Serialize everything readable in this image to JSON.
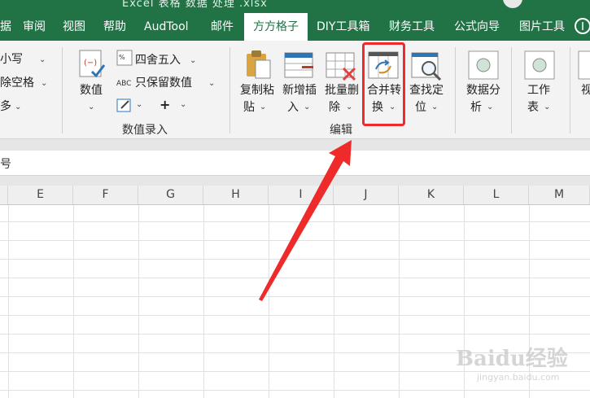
{
  "titlebar": {
    "title": "Excel 表格 数据 处理 .xlsx"
  },
  "tabs": [
    {
      "label": "据"
    },
    {
      "label": "审阅"
    },
    {
      "label": "视图"
    },
    {
      "label": "帮助"
    },
    {
      "label": "AudTool"
    },
    {
      "label": "邮件"
    },
    {
      "label": "方方格子",
      "active": true
    },
    {
      "label": "DIY工具箱"
    },
    {
      "label": "财务工具"
    },
    {
      "label": "公式向导"
    },
    {
      "label": "图片工具"
    }
  ],
  "ribbon": {
    "left_items": [
      "小写",
      "除空格",
      "多"
    ],
    "numeric": {
      "value_button": "数值",
      "round": "四舍五入",
      "keep_numbers": "只保留数值",
      "plus": "+",
      "group_label": "数值录入"
    },
    "edit": {
      "copy_paste": [
        "复制粘",
        "贴"
      ],
      "insert": [
        "新增插",
        "入"
      ],
      "batch_delete": [
        "批量删",
        "除"
      ],
      "merge_convert": [
        "合并转",
        "换"
      ],
      "find_locate": [
        "查找定",
        "位"
      ],
      "group_label": "编辑"
    },
    "data_analysis": [
      "数据分",
      "析"
    ],
    "worksheet": [
      "工作",
      "表"
    ],
    "partial": "视"
  },
  "formula_bar": {
    "name_box": "号"
  },
  "columns": [
    "E",
    "F",
    "G",
    "H",
    "I",
    "J",
    "K",
    "L",
    "M"
  ],
  "watermark": {
    "brand": "Baidu经验",
    "url": "jingyan.baidu.com"
  },
  "colors": {
    "accent": "#217346",
    "highlight": "#ee2a2a"
  }
}
